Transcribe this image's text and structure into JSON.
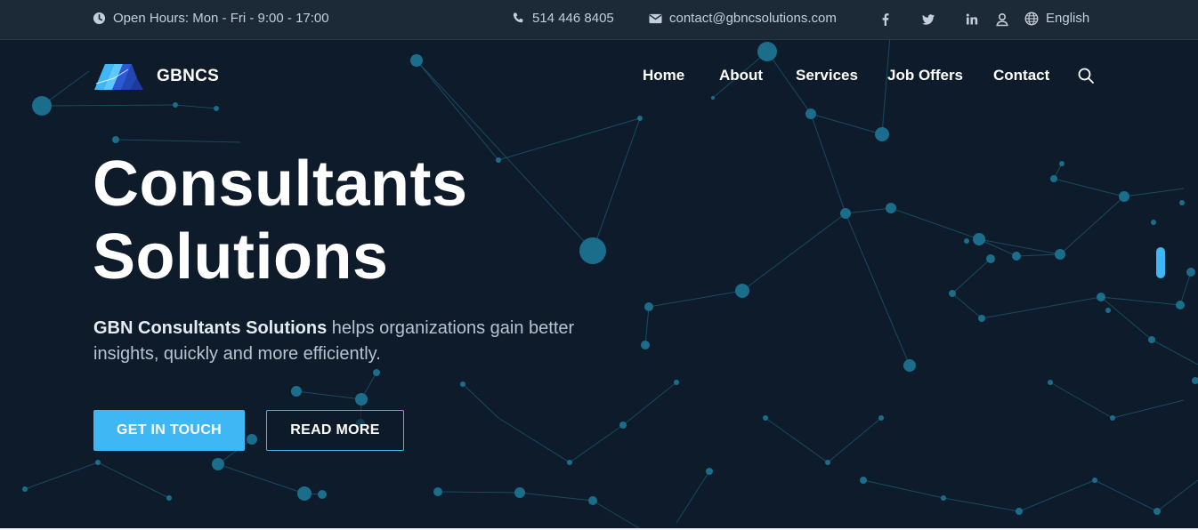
{
  "topbar": {
    "hours": "Open Hours: Mon - Fri - 9:00 - 17:00",
    "phone": "514 446 8405",
    "email": "contact@gbncsolutions.com",
    "language": "English",
    "icons": [
      "clock-icon",
      "phone-icon",
      "mail-icon",
      "facebook-icon",
      "twitter-icon",
      "linkedin-icon",
      "user-icon",
      "globe-icon"
    ]
  },
  "brand": {
    "name": "GBNCS"
  },
  "nav": {
    "items": [
      "Home",
      "About",
      "Services",
      "Job Offers",
      "Contact"
    ]
  },
  "hero": {
    "title_line1": "Consultants",
    "title_line2": "Solutions",
    "lead_strong": "GBN Consultants Solutions",
    "lead_rest": " helps organizations gain better insights, quickly and more efficiently.",
    "primary_cta": "GET IN TOUCH",
    "secondary_cta": "READ MORE"
  },
  "colors": {
    "background": "#0e1b2a",
    "topbar": "#1c2937",
    "accent": "#3fb7f5",
    "network": "#1f6e8c"
  }
}
